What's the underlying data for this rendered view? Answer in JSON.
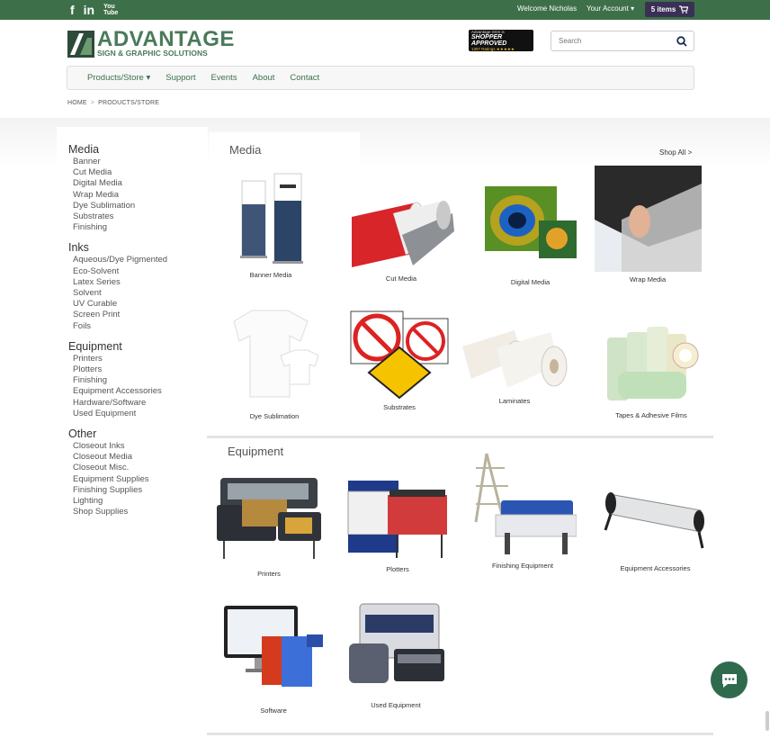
{
  "topbar": {
    "social": [
      "facebook-icon",
      "linkedin-icon",
      "youtube-icon"
    ],
    "facebook_glyph": "f",
    "linkedin_glyph": "in",
    "youtube_glyph": "You\nTube",
    "welcome": "Welcome Nicholas",
    "account": "Your Account ▾",
    "cart_label": "5 items"
  },
  "header": {
    "logo_main": "ADVANTAGE",
    "logo_sub": "SIGN & GRAPHIC SOLUTIONS",
    "badge_line1": "Advantage SGS is",
    "badge_line2": "SHOPPER APPROVED",
    "badge_line3": "1357 Ratings ★★★★★",
    "search_placeholder": "Search"
  },
  "nav": {
    "products": "Products/Store ▾",
    "support": "Support",
    "events": "Events",
    "about": "About",
    "contact": "Contact"
  },
  "breadcrumb": {
    "home": "HOME",
    "current": "PRODUCTS/STORE"
  },
  "sidebar": {
    "groups": [
      {
        "title": "Media",
        "items": [
          "Banner",
          "Cut Media",
          "Digital Media",
          "Wrap Media",
          "Dye Sublimation",
          "Substrates",
          "Finishing"
        ]
      },
      {
        "title": "Inks",
        "items": [
          "Aqueous/Dye Pigmented",
          "Eco-Solvent",
          "Latex Series",
          "Solvent",
          "UV Curable",
          "Screen Print",
          "Foils"
        ]
      },
      {
        "title": "Equipment",
        "items": [
          "Printers",
          "Plotters",
          "Finishing",
          "Equipment Accessories",
          "Hardware/Software",
          "Used Equipment"
        ]
      },
      {
        "title": "Other",
        "items": [
          "Closeout Inks",
          "Closeout Media",
          "Closeout Misc.",
          "Equipment Supplies",
          "Finishing Supplies",
          "Lighting",
          "Shop Supplies"
        ]
      }
    ]
  },
  "media": {
    "title": "Media",
    "shop_all": "Shop All >",
    "products": [
      "Banner Media",
      "Cut Media",
      "Digital Media",
      "Wrap Media",
      "Dye Sublimation",
      "Substrates",
      "Laminates",
      "Tapes & Adhesive Films"
    ]
  },
  "equipment": {
    "title": "Equipment",
    "products": [
      "Printers",
      "Plotters",
      "Finishing Equipment",
      "Equipment Accessories",
      "Software",
      "Used Equipment"
    ]
  },
  "colors": {
    "brand_green": "#3d7049",
    "cart_purple": "#3a2f55",
    "chat_green": "#2f6a4f"
  }
}
